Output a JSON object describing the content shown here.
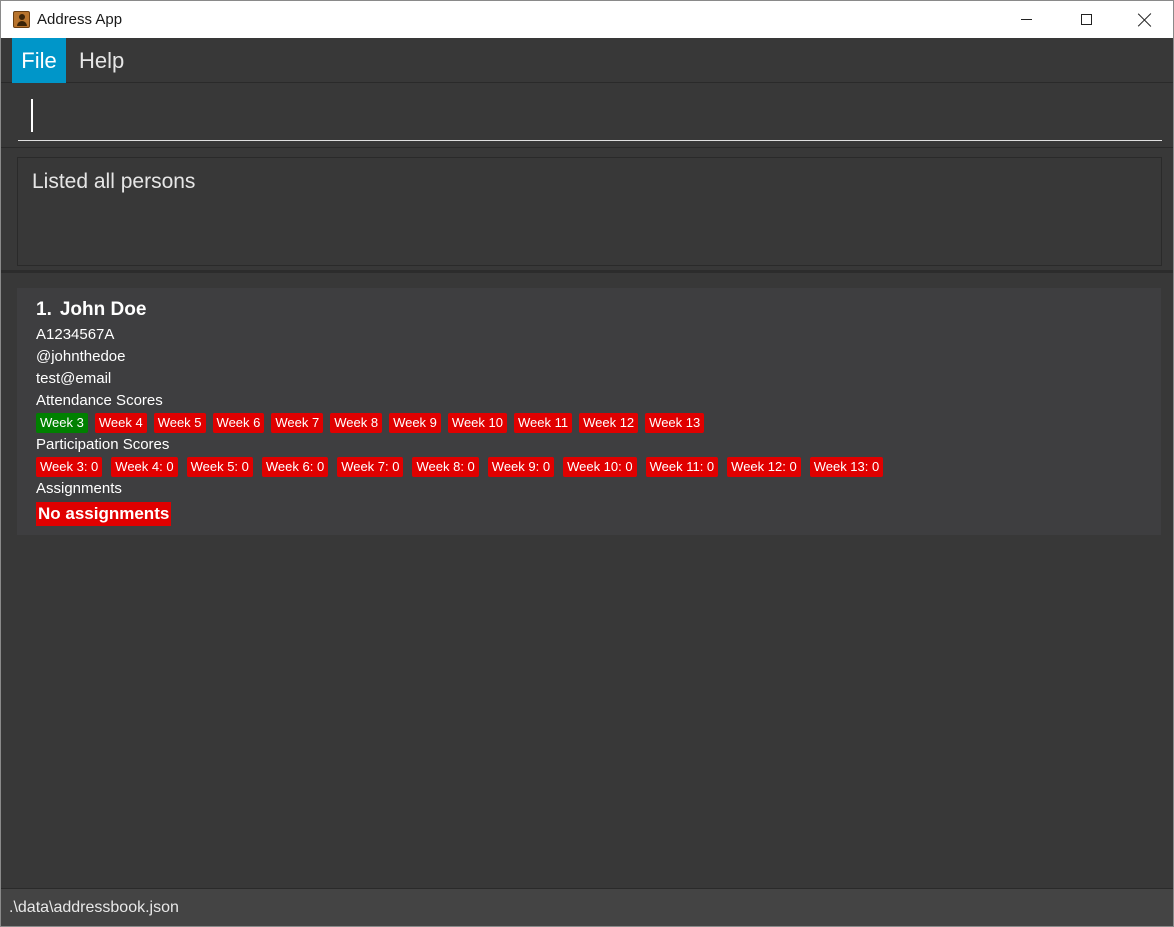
{
  "window": {
    "title": "Address App",
    "controls": {
      "minimize": "minimize-icon",
      "maximize": "maximize-icon",
      "close": "close-icon"
    }
  },
  "menu": {
    "file": "File",
    "help": "Help"
  },
  "command": {
    "value": "",
    "placeholder": ""
  },
  "result": {
    "text": "Listed all persons"
  },
  "persons": [
    {
      "index": "1.",
      "name": "John Doe",
      "student_id": "A1234567A",
      "telegram": "@johnthedoe",
      "email": "test@email",
      "attendance_label": "Attendance Scores",
      "attendance": [
        {
          "label": "Week 3",
          "status": "present"
        },
        {
          "label": "Week 4",
          "status": "absent"
        },
        {
          "label": "Week 5",
          "status": "absent"
        },
        {
          "label": "Week 6",
          "status": "absent"
        },
        {
          "label": "Week 7",
          "status": "absent"
        },
        {
          "label": "Week 8",
          "status": "absent"
        },
        {
          "label": "Week 9",
          "status": "absent"
        },
        {
          "label": "Week 10",
          "status": "absent"
        },
        {
          "label": "Week 11",
          "status": "absent"
        },
        {
          "label": "Week 12",
          "status": "absent"
        },
        {
          "label": "Week 13",
          "status": "absent"
        }
      ],
      "participation_label": "Participation Scores",
      "participation": [
        "Week 3: 0",
        "Week 4: 0",
        "Week 5: 0",
        "Week 6: 0",
        "Week 7: 0",
        "Week 8: 0",
        "Week 9: 0",
        "Week 10: 0",
        "Week 11: 0",
        "Week 12: 0",
        "Week 13: 0"
      ],
      "assignments_label": "Assignments",
      "assignments_empty": "No assignments"
    }
  ],
  "status": {
    "path": ".\\data\\addressbook.json"
  },
  "colors": {
    "accent": "#0096c9",
    "present": "#008000",
    "absent": "#e00000",
    "background": "#383838",
    "card": "#3e3e40"
  }
}
